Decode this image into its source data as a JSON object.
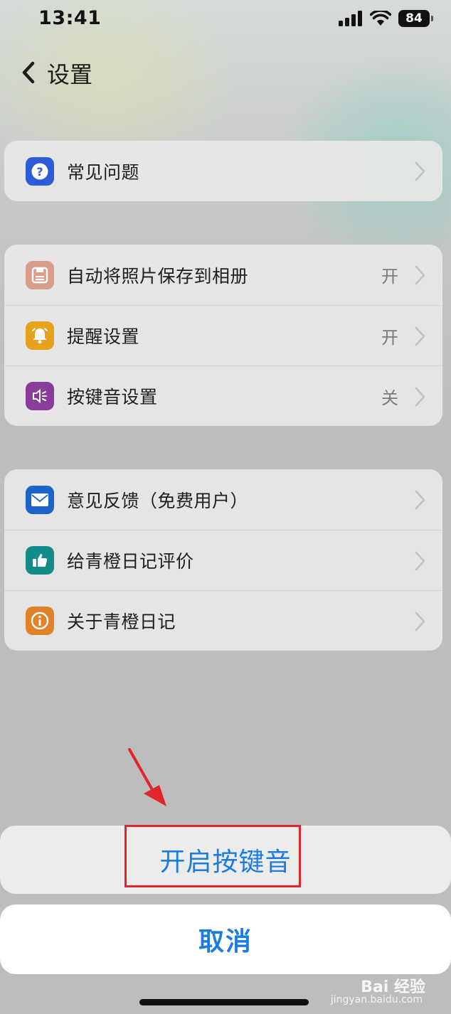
{
  "status_bar": {
    "time": "13:41",
    "battery": "84"
  },
  "nav": {
    "title": "设置"
  },
  "group1": [
    {
      "label": "常见问题",
      "value": "",
      "icon": "question-icon",
      "icon_color": "#2e5bd8"
    }
  ],
  "group2": [
    {
      "label": "自动将照片保存到相册",
      "value": "开",
      "icon": "save-icon",
      "icon_color": "#d99d8a"
    },
    {
      "label": "提醒设置",
      "value": "开",
      "icon": "bell-icon",
      "icon_color": "#e6a11d"
    },
    {
      "label": "按键音设置",
      "value": "关",
      "icon": "speaker-icon",
      "icon_color": "#8a3d98"
    }
  ],
  "group3": [
    {
      "label": "意见反馈（免费用户）",
      "value": "",
      "icon": "mail-icon",
      "icon_color": "#1c64c8"
    },
    {
      "label": "给青橙日记评价",
      "value": "",
      "icon": "thumbs-up-icon",
      "icon_color": "#148b8b"
    },
    {
      "label": "关于青橙日记",
      "value": "",
      "icon": "info-icon",
      "icon_color": "#e0822a"
    }
  ],
  "action_sheet": {
    "action_label": "开启按键音",
    "cancel_label": "取消"
  },
  "watermark": {
    "brand": "Bai 经验",
    "url": "jingyan.baidu.com"
  },
  "colors": {
    "accent": "#1a7be0",
    "highlight": "#e0262b"
  }
}
